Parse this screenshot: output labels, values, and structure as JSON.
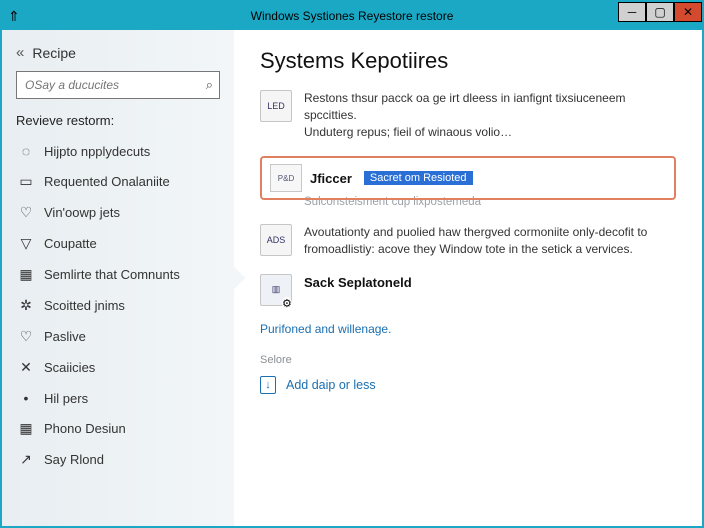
{
  "titlebar": {
    "title": "Windows Systiones Reyestore restore"
  },
  "sidebar": {
    "back_label": "Recipe",
    "search_placeholder": "OSay a ducucites",
    "section_title": "Revieve restorm:",
    "items": [
      {
        "icon": "◌",
        "label": "Hijpto npplydecuts"
      },
      {
        "icon": "▭",
        "label": "Requented Onalaniite"
      },
      {
        "icon": "♡",
        "label": "Vin'oowp jets"
      },
      {
        "icon": "▽",
        "label": "Coupatte"
      },
      {
        "icon": "▦",
        "label": "Semlirte that Comnunts"
      },
      {
        "icon": "✲",
        "label": "Scoitted jnims"
      },
      {
        "icon": "♡",
        "label": "Paslive"
      },
      {
        "icon": "✕",
        "label": "Scaiicies"
      },
      {
        "icon": "•",
        "label": "Hil pers"
      },
      {
        "icon": "▦",
        "label": "Phono Desiun"
      },
      {
        "icon": "↗",
        "label": "Say Rlond"
      }
    ]
  },
  "main": {
    "title": "Systems Kepotiires",
    "item1": {
      "icon_text": "LED",
      "line1": "Restons thsur pacck oa ge irt dleess in ianfignt tixsiuceneem spccitties.",
      "line2": "Unduterg repus; fieil of winaous volio…"
    },
    "highlight": {
      "icon_text": "P&D",
      "title": "Jficcer",
      "badge": "Sacret om Resioted",
      "sub": ""
    },
    "sub_gray": "Sulconsteisment cup lixpostemeda",
    "item3": {
      "icon_text": "ADS",
      "line1": "Avoutationty and puolied haw thergved cormoniite only-decofit to",
      "line2": "fromoadlistiy: acove they Window tote in the setick a vervices."
    },
    "item4": {
      "icon_text": "",
      "title": "Sack Seplatoneld"
    },
    "link": "Purifoned and willenage.",
    "selore_label": "Selore",
    "add_label": "Add daip or less"
  }
}
